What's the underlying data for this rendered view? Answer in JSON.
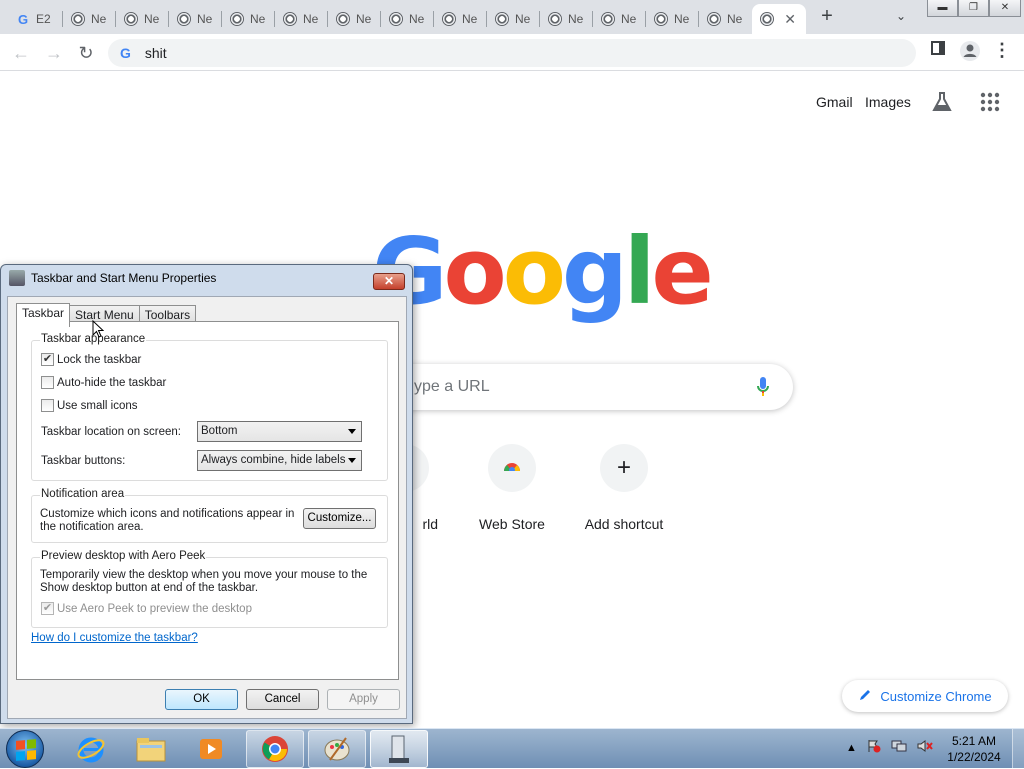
{
  "browser": {
    "tabs": [
      {
        "label": "E2",
        "favicon": "google-g-icon"
      },
      {
        "label": "Ne",
        "favicon": "chrome-icon"
      },
      {
        "label": "Ne",
        "favicon": "chrome-icon"
      },
      {
        "label": "Ne",
        "favicon": "chrome-icon"
      },
      {
        "label": "Ne",
        "favicon": "chrome-icon"
      },
      {
        "label": "Ne",
        "favicon": "chrome-icon"
      },
      {
        "label": "Ne",
        "favicon": "chrome-icon"
      },
      {
        "label": "Ne",
        "favicon": "chrome-icon"
      },
      {
        "label": "Ne",
        "favicon": "chrome-icon"
      },
      {
        "label": "Ne",
        "favicon": "chrome-icon"
      },
      {
        "label": "Ne",
        "favicon": "chrome-icon"
      },
      {
        "label": "Ne",
        "favicon": "chrome-icon"
      },
      {
        "label": "Ne",
        "favicon": "chrome-icon"
      },
      {
        "label": "Ne",
        "favicon": "chrome-icon"
      }
    ],
    "omnibox_text": "shit",
    "new_tab_symbol": "+",
    "close_symbol": "✕"
  },
  "google": {
    "gmail": "Gmail",
    "images": "Images",
    "logo_letters": [
      "G",
      "o",
      "o",
      "g",
      "l",
      "e"
    ],
    "search_placeholder": "ype a URL",
    "shortcuts": [
      {
        "label": "rld"
      },
      {
        "label": "Web Store"
      },
      {
        "label": "Add shortcut"
      }
    ],
    "customize_label": "Customize Chrome"
  },
  "dialog": {
    "title": "Taskbar and Start Menu Properties",
    "tabs": [
      "Taskbar",
      "Start Menu",
      "Toolbars"
    ],
    "appearance": {
      "title": "Taskbar appearance",
      "lock": {
        "label": "Lock the taskbar",
        "checked": true
      },
      "autohide": {
        "label": "Auto-hide the taskbar",
        "checked": false
      },
      "small_icons": {
        "label": "Use small icons",
        "checked": false
      },
      "location_label": "Taskbar location on screen:",
      "location_value": "Bottom",
      "buttons_label": "Taskbar buttons:",
      "buttons_value": "Always combine, hide labels"
    },
    "notification": {
      "title": "Notification area",
      "text": "Customize which icons and notifications appear in the notification area.",
      "button": "Customize..."
    },
    "aero": {
      "title": "Preview desktop with Aero Peek",
      "text": "Temporarily view the desktop when you move your mouse to the Show desktop button at end of the taskbar.",
      "checkbox": {
        "label": "Use Aero Peek to preview the desktop",
        "checked": true,
        "disabled": true
      }
    },
    "help_link": "How do I customize the taskbar?",
    "ok": "OK",
    "cancel": "Cancel",
    "apply": "Apply"
  },
  "taskbar": {
    "time": "5:21 AM",
    "date": "1/22/2024",
    "items": [
      "internet-explorer-icon",
      "file-explorer-icon",
      "media-player-icon",
      "chrome-icon",
      "paint-icon",
      "taskbar-properties-icon"
    ]
  }
}
